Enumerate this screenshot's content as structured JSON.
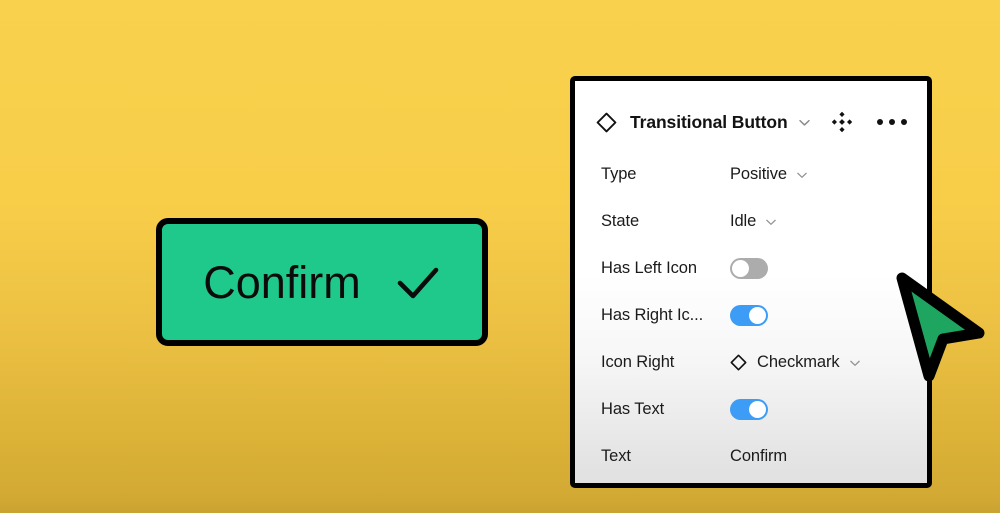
{
  "canvas": {
    "background_top_color": "#F9D14C",
    "background_bottom_color": "#C9A231"
  },
  "preview": {
    "component": "confirm-button",
    "label": "Confirm",
    "right_icon": "checkmark-icon",
    "fill_color": "#1FC98B",
    "border_color": "#000000",
    "text_color": "#0B0B0B"
  },
  "panel": {
    "header": {
      "component_icon": "component-diamond-icon",
      "title": "Transitional Button",
      "title_chevron": "chevron-down-icon",
      "variants_icon": "variants-icon",
      "more_icon": "more-options-icon"
    },
    "properties": [
      {
        "label": "Type",
        "control": "select",
        "value": "Positive",
        "chevron": "chevron-down-icon"
      },
      {
        "label": "State",
        "control": "select",
        "value": "Idle",
        "chevron": "chevron-down-icon"
      },
      {
        "label": "Has Left Icon",
        "control": "toggle",
        "value": "off"
      },
      {
        "label": "Has Right Ic...",
        "control": "toggle",
        "value": "on"
      },
      {
        "label": "Icon Right",
        "control": "icon-select",
        "value": "Checkmark",
        "icon": "component-diamond-icon",
        "chevron": "chevron-down-icon"
      },
      {
        "label": "Has Text",
        "control": "toggle",
        "value": "on"
      },
      {
        "label": "Text",
        "control": "text",
        "value": "Confirm"
      }
    ],
    "colors": {
      "toggle_on": "#3C9CF6",
      "toggle_off": "#ACACAC",
      "border": "#000000"
    }
  },
  "cursor": {
    "icon": "arrow-pointer-icon",
    "fill_color": "#1EA55F",
    "outline_color": "#000000"
  }
}
